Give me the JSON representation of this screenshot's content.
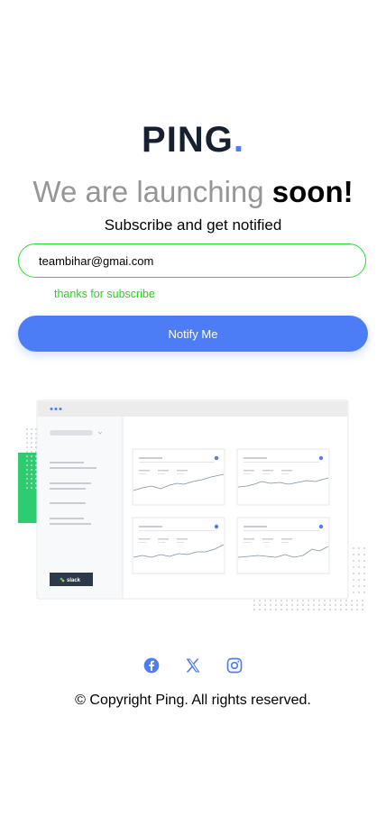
{
  "logo": {
    "text": "PING",
    "dot": "."
  },
  "headline": {
    "light": "We are launching",
    "bold": "soon!"
  },
  "subtitle": "Subscribe and get notified",
  "email": {
    "value": "teambihar@gmai.com",
    "placeholder": ""
  },
  "success_message": "thanks for subscribe",
  "notify_button": "Notify Me",
  "illustration": {
    "slack_label": "slack"
  },
  "social": [
    {
      "icon": "facebook-icon"
    },
    {
      "icon": "x-twitter-icon"
    },
    {
      "icon": "instagram-icon"
    }
  ],
  "copyright": "© Copyright Ping. All rights reserved.",
  "colors": {
    "brand_blue": "#4d7df6",
    "success_green": "#22e02a",
    "dark": "#17202e"
  }
}
